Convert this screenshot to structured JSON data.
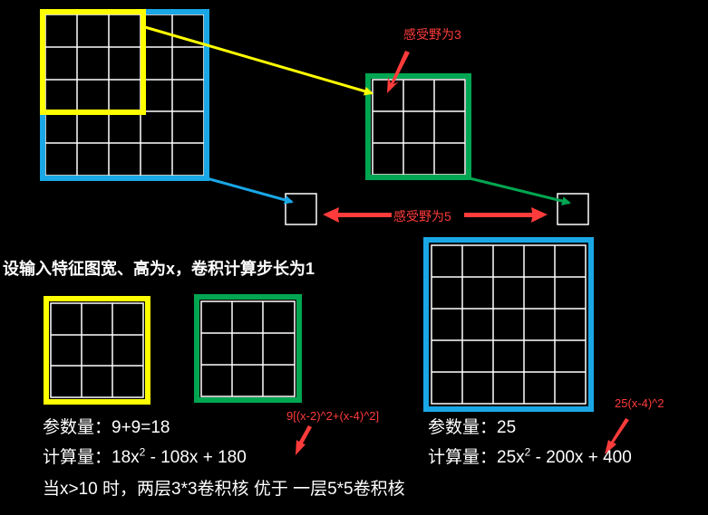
{
  "annotations": {
    "rf3": "感受野为3",
    "rf5": "感受野为5",
    "formula_small": "9[(x-2)^2+(x-4)^2]",
    "formula_large": "25(x-4)^2"
  },
  "heading": "设输入特征图宽、高为x，卷积计算步长为1",
  "left_stats": {
    "params": "参数量：9+9=18",
    "compute_prefix": "计算量：",
    "compute_a": "18x",
    "compute_exp": "2",
    "compute_b": " - 108x + 180"
  },
  "right_stats": {
    "params": "参数量：25",
    "compute_prefix": "计算量：",
    "compute_a": "25x",
    "compute_exp": "2",
    "compute_b": " - 200x + 400"
  },
  "conclusion": "当x>10 时，两层3*3卷积核 优于 一层5*5卷积核",
  "colors": {
    "yellow": "#ffff00",
    "blue": "#1aa7e6",
    "green": "#00a651",
    "red": "#ff3b3b",
    "grid": "#ffffff"
  }
}
